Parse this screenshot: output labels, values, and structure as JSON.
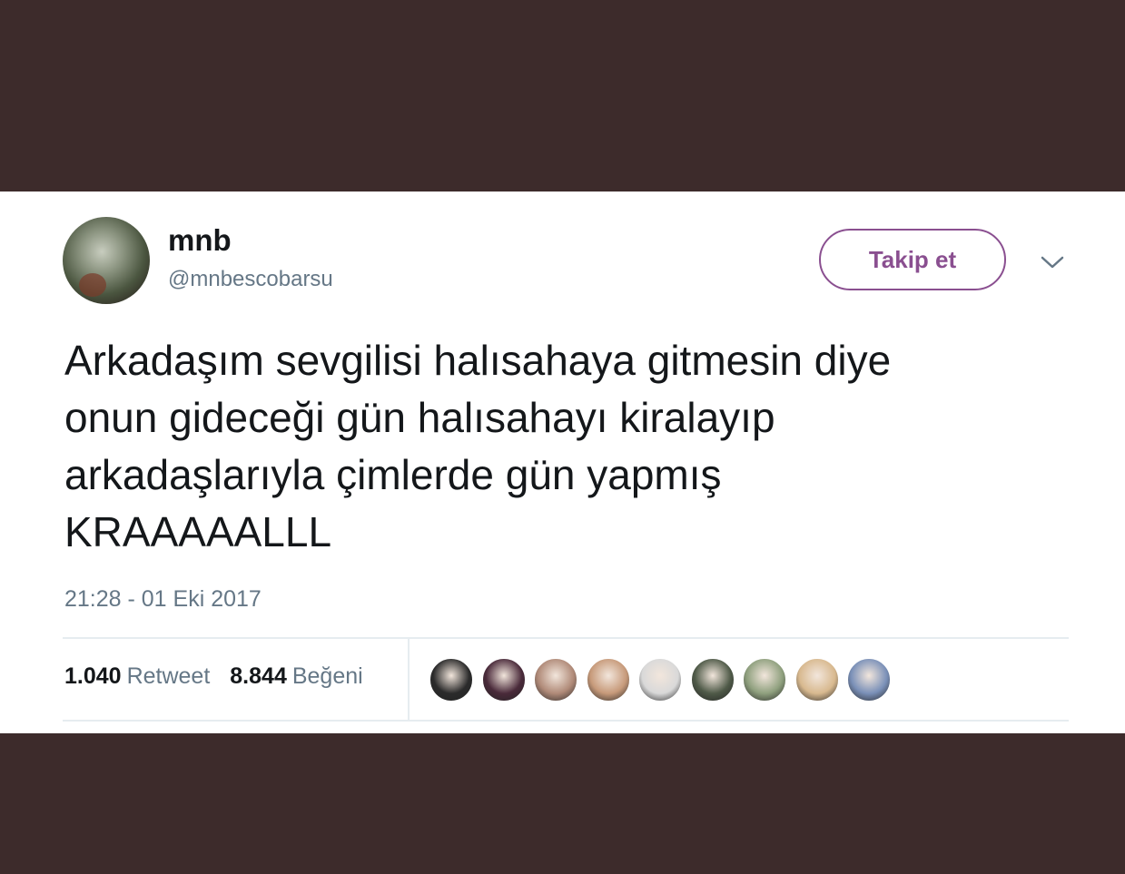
{
  "user": {
    "display_name": "mnb",
    "handle": "@mnbescobarsu"
  },
  "follow_button": {
    "label": "Takip et"
  },
  "tweet": {
    "text": "Arkadaşım sevgilisi halısahaya gitmesin diye\nonun gideceği gün halısahayı kiralayıp\narkadaşlarıyla çimlerde gün yapmış\nKRAAAAALLL",
    "timestamp": "21:28 - 01 Eki 2017"
  },
  "stats": {
    "retweet_count": "1.040",
    "retweet_label": "Retweet",
    "like_count": "8.844",
    "like_label": "Beğeni"
  },
  "icons": {
    "more_menu": "chevron-down-icon"
  },
  "colors": {
    "accent": "#8a4f90",
    "text": "#14171a",
    "muted": "#657786",
    "frame": "#3d2b2b"
  },
  "likers": [
    {
      "color": "#2b2b2b"
    },
    {
      "color": "#4a2a3a"
    },
    {
      "color": "#b08a78"
    },
    {
      "color": "#c79a7a"
    },
    {
      "color": "#d9d9d9"
    },
    {
      "color": "#4f5a48"
    },
    {
      "color": "#8fa07e"
    },
    {
      "color": "#d8b98f"
    },
    {
      "color": "#7a90b8"
    }
  ]
}
